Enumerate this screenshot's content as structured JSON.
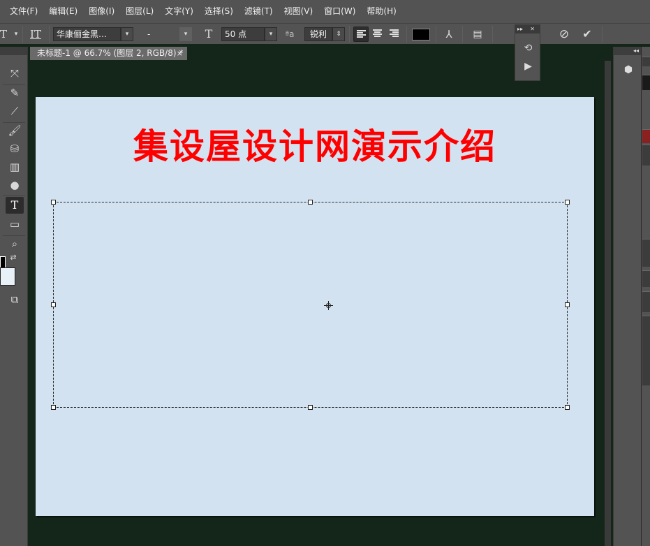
{
  "menu": [
    "文件(F)",
    "编辑(E)",
    "图像(I)",
    "图层(L)",
    "文字(Y)",
    "选择(S)",
    "滤镜(T)",
    "视图(V)",
    "窗口(W)",
    "帮助(H)"
  ],
  "options": {
    "font_family": "华康俪金黑…",
    "font_style": "-",
    "font_size": "50 点",
    "antialias": "锐利",
    "text_color": "#000000"
  },
  "document": {
    "tab_title": "未标题-1 @ 66.7% (图层 2, RGB/8) *",
    "tab_close": "×",
    "canvas_color": "#d2e2f0",
    "headline": "集设屋设计网演示介绍",
    "headline_color": "#ff0000"
  },
  "toolbar": {
    "tools": [
      "move-tool",
      "quick-selection-tool",
      "eyedropper-tool",
      "brush-tool",
      "clone-stamp-tool",
      "gradient-tool",
      "dodge-tool",
      "type-tool",
      "rectangle-tool",
      "zoom-tool",
      "swap-colors",
      "screen-mode"
    ],
    "active_tool": "type-tool",
    "foreground_color": "#000000",
    "background_color": "#e8f0f8"
  }
}
